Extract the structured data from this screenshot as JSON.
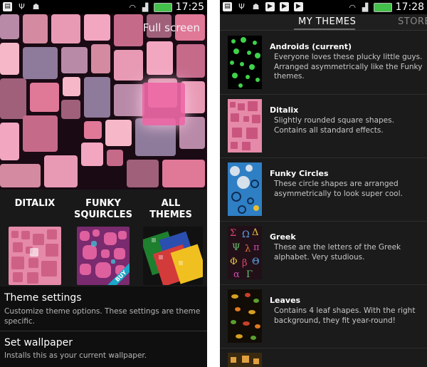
{
  "status_left": {
    "time": "17:25"
  },
  "status_right": {
    "time": "17:28"
  },
  "wallpaper": {
    "fullscreen_label": "Full screen"
  },
  "theme_cards": [
    {
      "title": "DITALIX",
      "badge": ""
    },
    {
      "title": "FUNKY SQUIRCLES",
      "badge": "BUY"
    },
    {
      "title": "ALL THEMES",
      "badge": ""
    }
  ],
  "menu": {
    "theme_settings_title": "Theme settings",
    "theme_settings_desc": "Customize theme options. These settings are theme specific.",
    "set_wallpaper_title": "Set wallpaper",
    "set_wallpaper_desc": "Installs this as your current wallpaper."
  },
  "tabs": {
    "my_themes": "MY THEMES",
    "store": "STORE"
  },
  "themes": [
    {
      "name": "Androids (current)",
      "description": "Everyone loves these plucky little guys. Arranged asymmetrically like the Funky themes."
    },
    {
      "name": "Ditalix",
      "description": "Slightly rounded square shapes. Contains all standard effects."
    },
    {
      "name": "Funky Circles",
      "description": "These circle shapes are arranged asymmetrically to look super cool."
    },
    {
      "name": "Greek",
      "description": "These are the letters of the Greek alphabet. Very studious."
    },
    {
      "name": "Leaves",
      "description": "Contains 4 leaf shapes. With the right background, they fit year-round!"
    }
  ],
  "colors": {
    "accent_pink": "#f06aa8",
    "battery_green": "#43c04a",
    "buy_blue": "#1aa7c9"
  }
}
